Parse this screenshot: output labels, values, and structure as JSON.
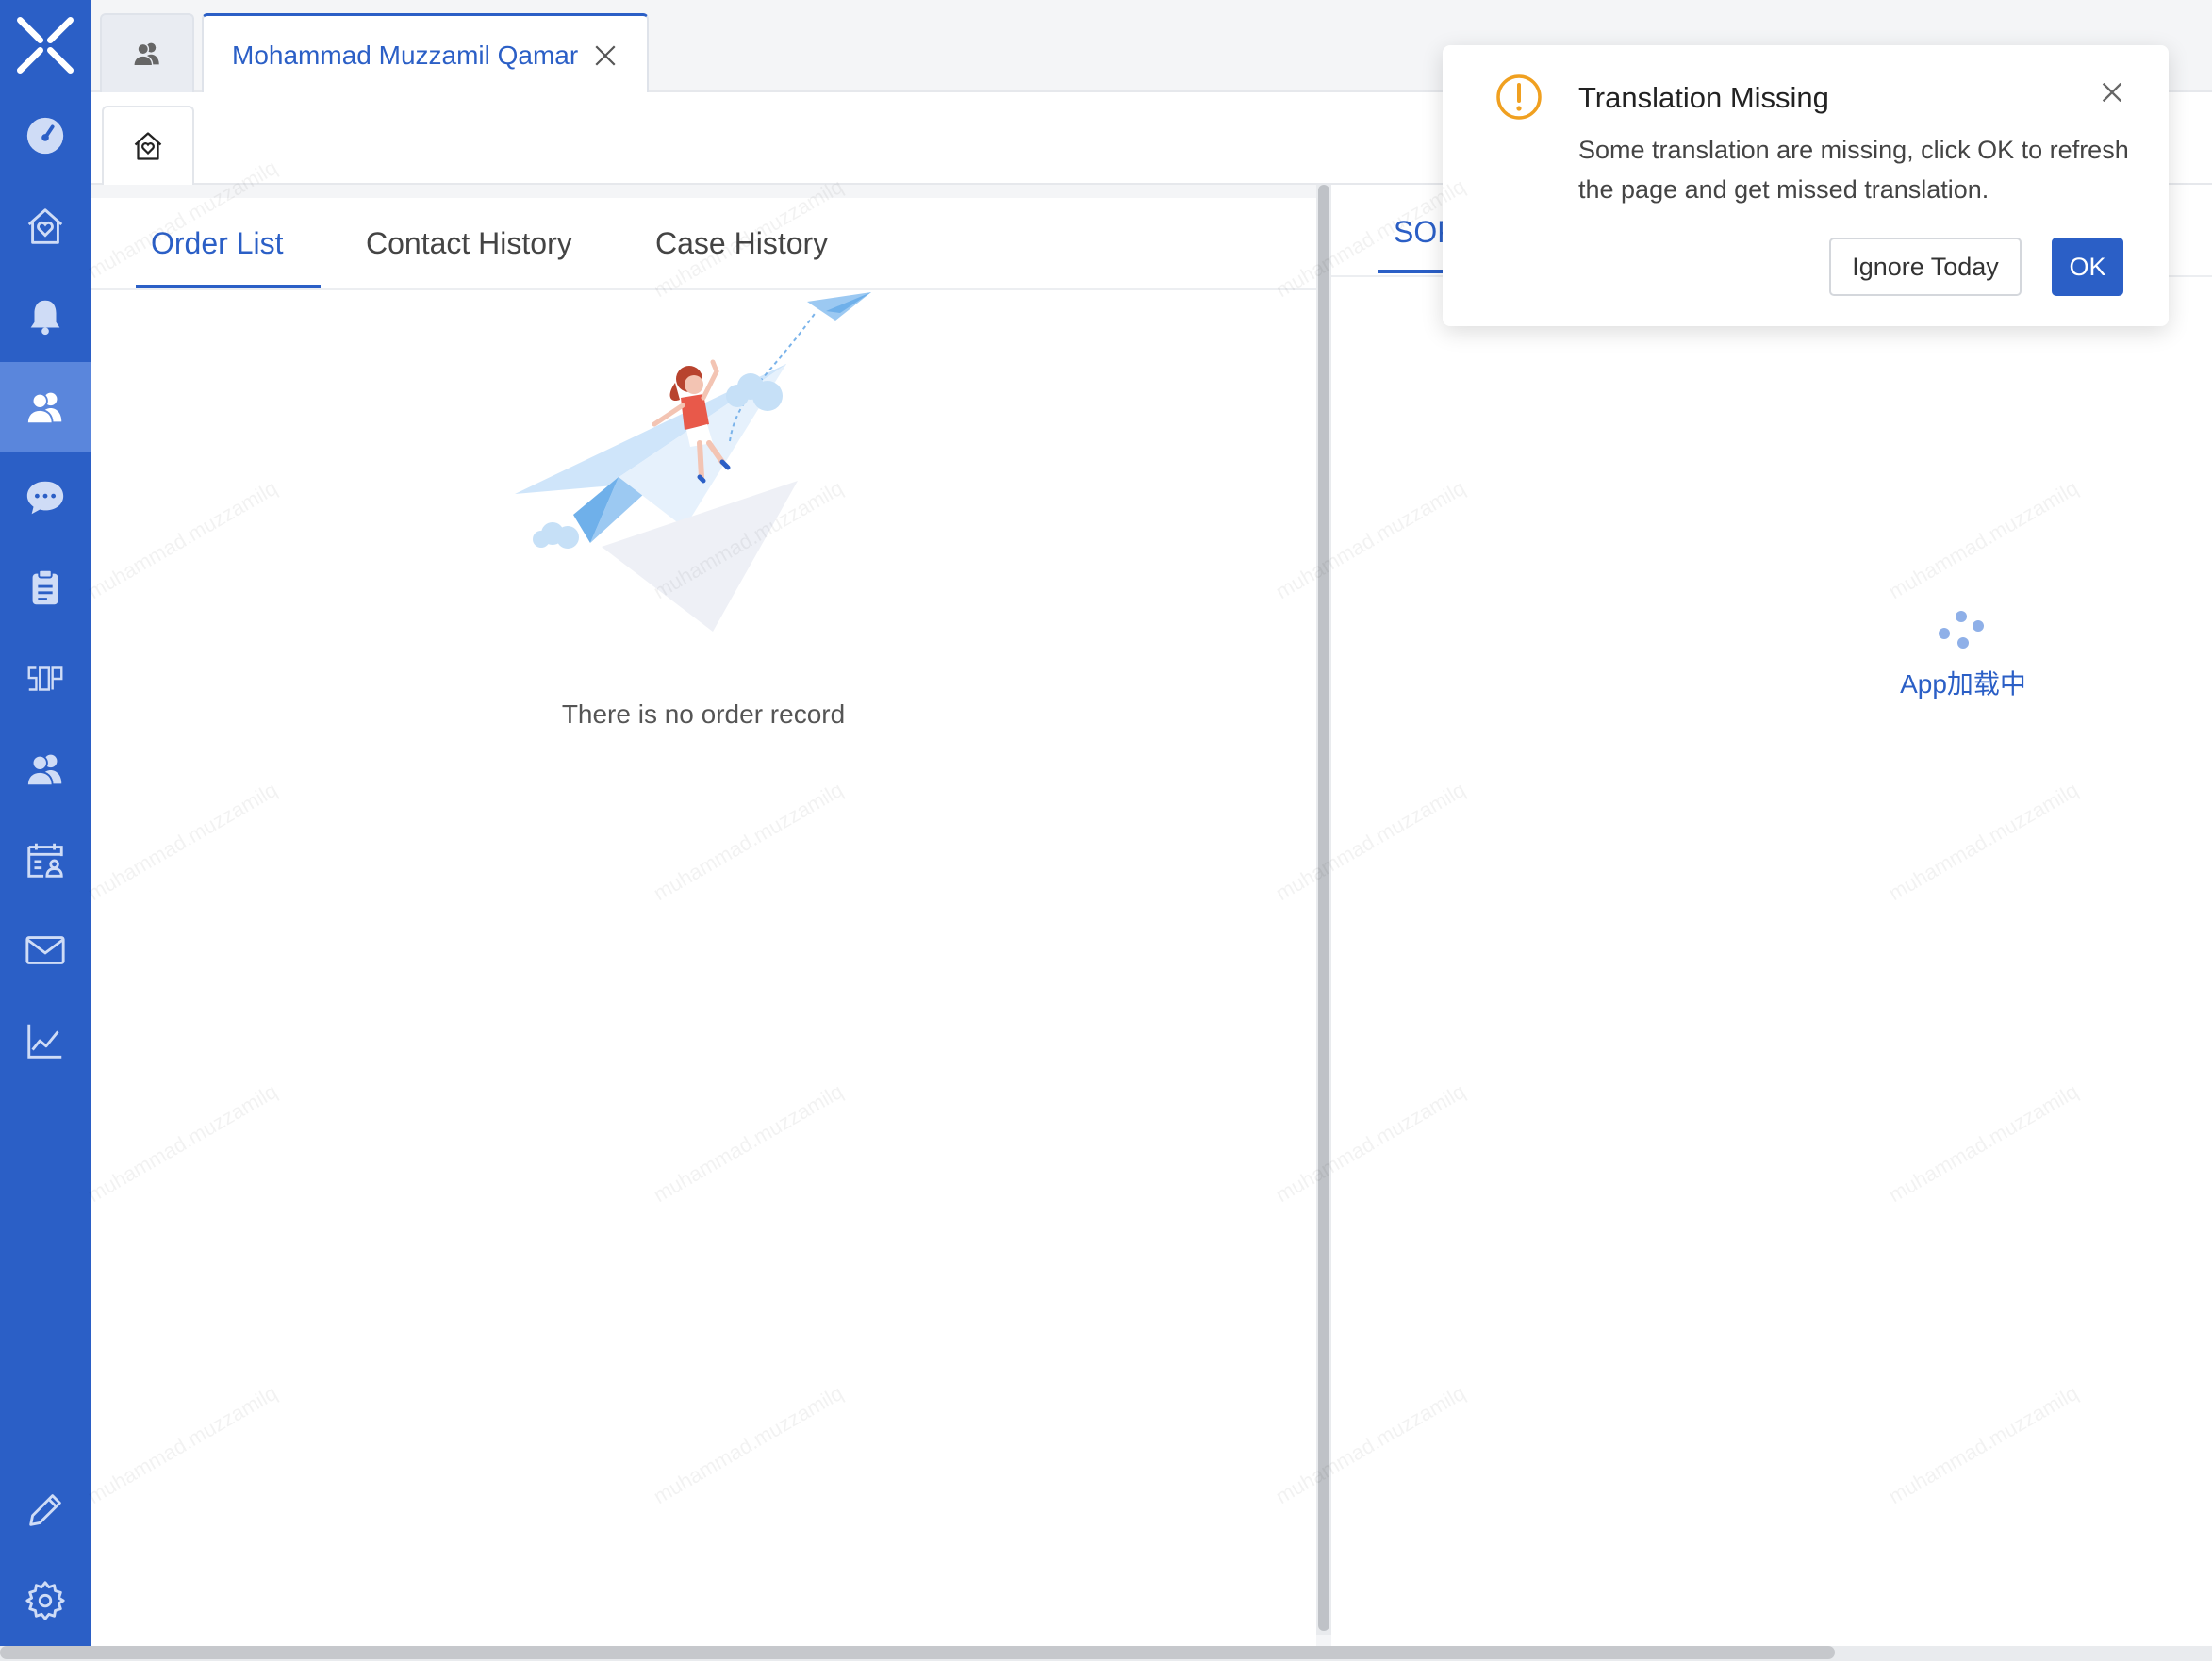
{
  "app": {
    "brand_color": "#2b5fc6",
    "logo_icon": "x-logo-icon"
  },
  "sidebar": {
    "items": [
      {
        "name": "dashboard",
        "icon": "speedometer-icon"
      },
      {
        "name": "home",
        "icon": "home-heart-icon"
      },
      {
        "name": "notifications",
        "icon": "bell-icon"
      },
      {
        "name": "customers",
        "icon": "users-icon",
        "active": true
      },
      {
        "name": "chat",
        "icon": "chat-bubble-icon"
      },
      {
        "name": "tickets",
        "icon": "clipboard-icon"
      },
      {
        "name": "sop",
        "icon": "sop-icon",
        "label": "SOP"
      },
      {
        "name": "contacts",
        "icon": "users-icon"
      },
      {
        "name": "schedule",
        "icon": "calendar-user-icon"
      },
      {
        "name": "mail",
        "icon": "mail-icon"
      },
      {
        "name": "reports",
        "icon": "line-chart-icon"
      }
    ],
    "bottom": [
      {
        "name": "edit",
        "icon": "pencil-icon"
      },
      {
        "name": "settings",
        "icon": "gear-icon"
      }
    ]
  },
  "tabs": {
    "customer_tab_label": "Mohammad Muzzamil Qamar"
  },
  "left_panel": {
    "tabs": [
      "Order List",
      "Contact History",
      "Case History"
    ],
    "active_tab": "Order List",
    "empty_message": "There is no order record"
  },
  "right_panel": {
    "tab_label": "SOP",
    "loading_text": "App加载中"
  },
  "notification": {
    "title": "Translation Missing",
    "body": "Some translation are missing, click OK to refresh the page and get missed translation.",
    "ignore_label": "Ignore Today",
    "ok_label": "OK",
    "warning_color": "#f0a020"
  },
  "watermark": "muhammad.muzzamilq"
}
